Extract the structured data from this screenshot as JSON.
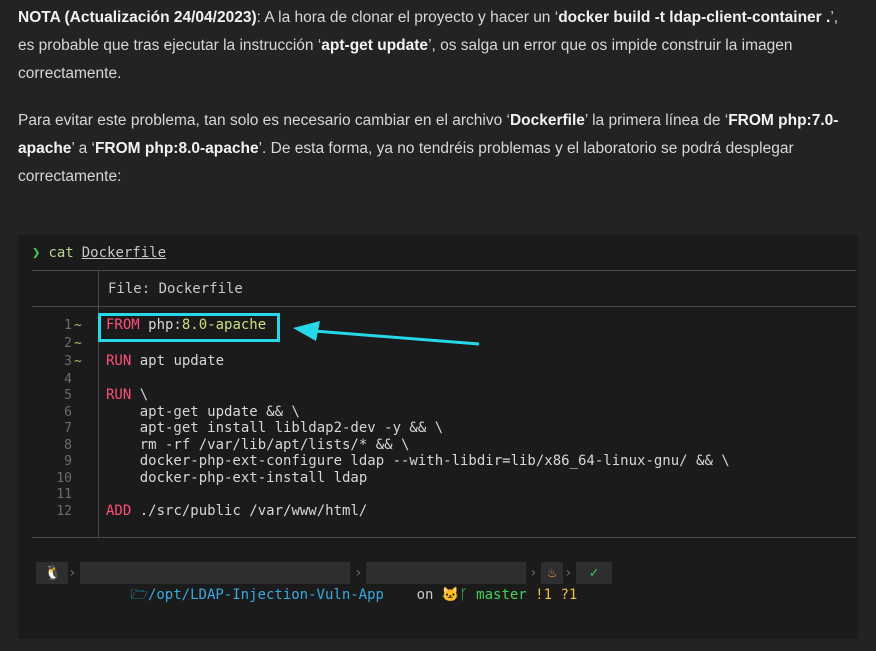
{
  "prose": {
    "p1": [
      {
        "text": "NOTA (Actualización 24/04/2023)",
        "bold": true
      },
      {
        "text": ": A la hora de clonar el proyecto y hacer un ‘",
        "bold": false
      },
      {
        "text": "docker build -t ldap-client-container .",
        "bold": true
      },
      {
        "text": "’, es probable que tras ejecutar la instrucción ‘",
        "bold": false
      },
      {
        "text": "apt-get update",
        "bold": true
      },
      {
        "text": "’, os salga un error que os impide construir la imagen correctamente.",
        "bold": false
      }
    ],
    "p2": [
      {
        "text": "Para evitar este problema, tan solo es necesario cambiar en el archivo ‘",
        "bold": false
      },
      {
        "text": "Dockerfile",
        "bold": true
      },
      {
        "text": "’ la primera línea de ‘",
        "bold": false
      },
      {
        "text": "FROM php:7.0-apache",
        "bold": true
      },
      {
        "text": "’ a ‘",
        "bold": false
      },
      {
        "text": "FROM php:8.0-apache",
        "bold": true
      },
      {
        "text": "’. De esta forma, ya no tendréis problemas y el laboratorio se podrá desplegar correctamente:",
        "bold": false
      }
    ]
  },
  "terminal": {
    "prompt_symbol": "❯",
    "command": "cat",
    "argument": "Dockerfile",
    "file_header": "File: Dockerfile",
    "lines": [
      {
        "n": "1",
        "mod": "~",
        "kw": "FROM",
        "rest": " php:",
        "str": "8.0-apache"
      },
      {
        "n": "2",
        "mod": "~",
        "kw": "",
        "rest": "",
        "str": ""
      },
      {
        "n": "3",
        "mod": "~",
        "kw": "RUN",
        "rest": " apt update",
        "str": ""
      },
      {
        "n": "4",
        "mod": "",
        "kw": "",
        "rest": "",
        "str": ""
      },
      {
        "n": "5",
        "mod": "",
        "kw": "RUN",
        "rest": " \\",
        "str": ""
      },
      {
        "n": "6",
        "mod": "",
        "kw": "",
        "rest": "    apt-get update && \\",
        "str": ""
      },
      {
        "n": "7",
        "mod": "",
        "kw": "",
        "rest": "    apt-get install libldap2-dev -y && \\",
        "str": ""
      },
      {
        "n": "8",
        "mod": "",
        "kw": "",
        "rest": "    rm -rf /var/lib/apt/lists/* && \\",
        "str": ""
      },
      {
        "n": "9",
        "mod": "",
        "kw": "",
        "rest": "    docker-php-ext-configure ldap --with-libdir=lib/x86_64-linux-gnu/ && \\",
        "str": ""
      },
      {
        "n": "10",
        "mod": "",
        "kw": "",
        "rest": "    docker-php-ext-install ldap",
        "str": ""
      },
      {
        "n": "11",
        "mod": "",
        "kw": "",
        "rest": "",
        "str": ""
      },
      {
        "n": "12",
        "mod": "",
        "kw": "ADD",
        "rest": " ./src/public /var/www/html/",
        "str": ""
      }
    ],
    "status": {
      "os_icon": "linux-penguin-icon",
      "folder_icon": "folder-icon",
      "path": "/opt/LDAP-Injection-Vuln-App",
      "on_label": "on",
      "git_icon": "github-cat-icon",
      "branch": "master",
      "git_status": "!1 ?1",
      "fire_icon": "fire-icon",
      "ok_icon": "check-icon"
    }
  },
  "colors": {
    "accent_box": "#27d8e8",
    "keyword": "#ff4f78",
    "string": "#c8e07a",
    "path": "#39a9e0",
    "branch": "#43d05a"
  }
}
